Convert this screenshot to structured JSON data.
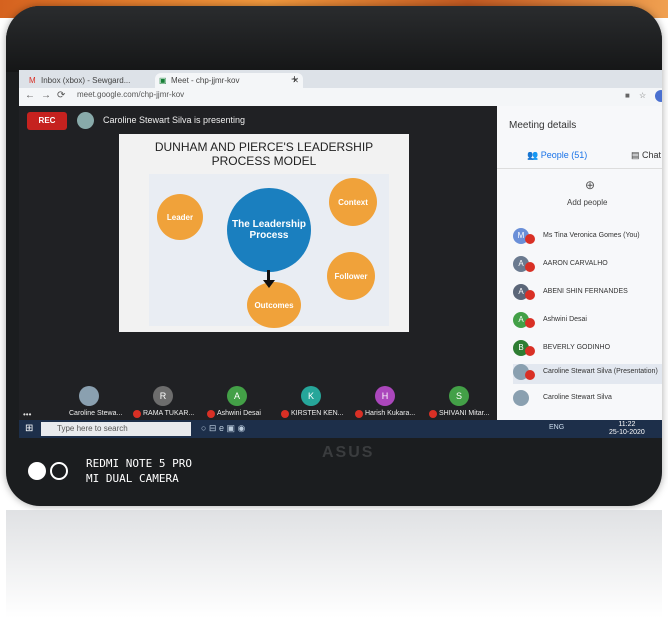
{
  "browser": {
    "tab1_label": "Inbox (xbox) - Sewgard...",
    "tab2_label": "Meet - chp-jjmr-kov",
    "url": "meet.google.com/chp-jjmr-kov"
  },
  "meet": {
    "rec_label": "REC",
    "presenter_text": "Caroline Stewart Silva is presenting",
    "slide_title_line1": "DUNHAM AND PIERCE'S LEADERSHIP",
    "slide_title_line2": "PROCESS MODEL",
    "diagram": {
      "leader": "Leader",
      "center": "The Leadership Process",
      "context": "Context",
      "follower": "Follower",
      "outcomes": "Outcomes"
    }
  },
  "sidebar": {
    "title": "Meeting details",
    "people_tab": "People (51)",
    "chat_tab": "Chat",
    "add_people": "Add people",
    "participants": [
      {
        "initial": "M",
        "name": "Ms Tina Veronica Gomes (You)",
        "color": "#6a8fd8"
      },
      {
        "initial": "A",
        "name": "AARON CARVALHO",
        "color": "#6b7a8f"
      },
      {
        "initial": "A",
        "name": "ABENI SHIN FERNANDES",
        "color": "#5b6678"
      },
      {
        "initial": "A",
        "name": "Ashwini Desai",
        "color": "#43a047"
      },
      {
        "initial": "B",
        "name": "BEVERLY GODINHO",
        "color": "#2e7d32"
      },
      {
        "initial": "C",
        "name": "Caroline Stewart Silva (Presentation)",
        "color": "#8aa0b0"
      },
      {
        "initial": "C",
        "name": "Caroline Stewart Silva",
        "color": "#8aa0b0"
      }
    ]
  },
  "tiles": [
    {
      "initial": "",
      "name": "Caroline Stewa...",
      "color": "#8aa0b0"
    },
    {
      "initial": "R",
      "name": "RAMA TUKAR...",
      "color": "#6d6d6d"
    },
    {
      "initial": "A",
      "name": "Ashwini Desai",
      "color": "#43a047"
    },
    {
      "initial": "K",
      "name": "KIRSTEN KEN...",
      "color": "#26a69a"
    },
    {
      "initial": "H",
      "name": "Harish Kukara...",
      "color": "#ab47bc"
    },
    {
      "initial": "S",
      "name": "SHIVANI Mitar...",
      "color": "#43a047"
    }
  ],
  "taskbar": {
    "search_placeholder": "Type here to search",
    "tray": "ENG",
    "time": "11:22",
    "date": "25-10-2020"
  },
  "brand": "ASUS",
  "watermark_line1": "REDMI NOTE 5 PRO",
  "watermark_line2": "MI DUAL CAMERA"
}
